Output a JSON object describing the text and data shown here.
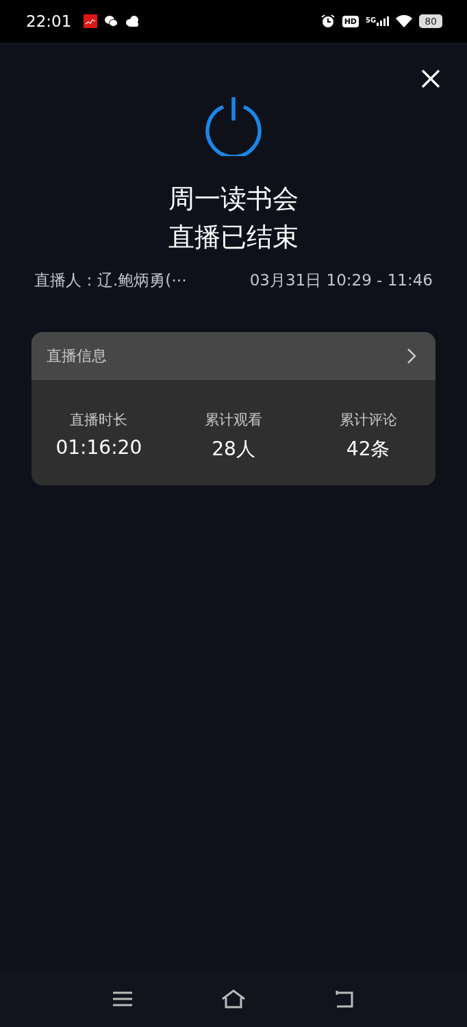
{
  "status_bar": {
    "time": "22:01",
    "hd": "HD",
    "network": "5G",
    "battery": "80"
  },
  "title_lines": [
    "周一读书会",
    "直播已结束"
  ],
  "host": "直播人：辽.鲍炳勇(⋯",
  "time_range": "03月31日 10:29 - 11:46",
  "info_card": {
    "header": "直播信息",
    "stats": [
      {
        "label": "直播时长",
        "value": "01:16:20"
      },
      {
        "label": "累计观看",
        "value": "28人"
      },
      {
        "label": "累计评论",
        "value": "42条"
      }
    ]
  }
}
